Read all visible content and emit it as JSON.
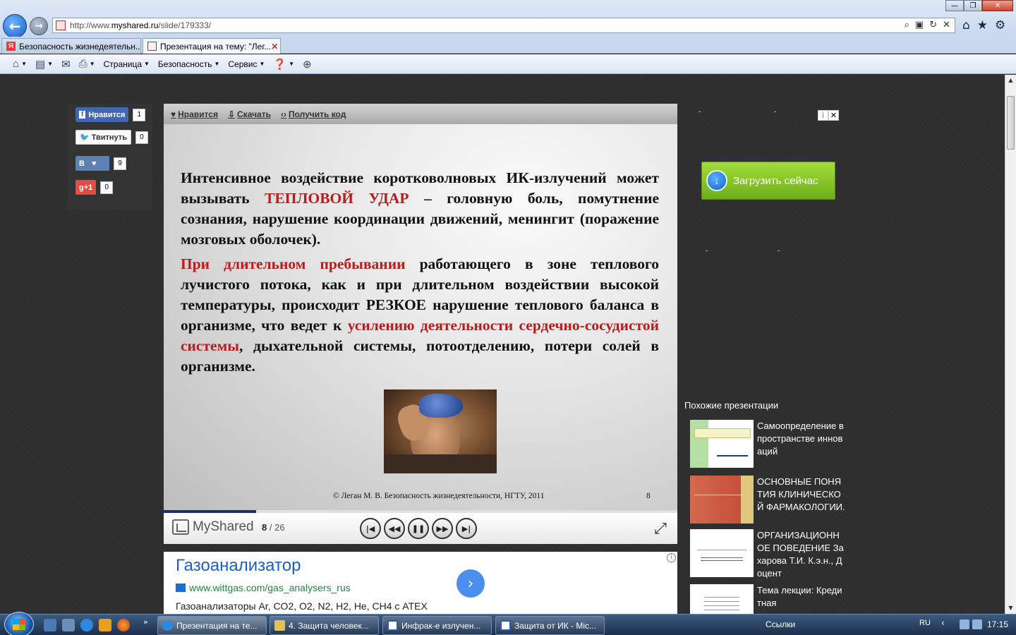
{
  "browser": {
    "url_prefix": "http://www.",
    "url_domain": "myshared.ru",
    "url_path": "/slide/179333/",
    "tabs": [
      {
        "label": "Безопасность жизнедеятельн..."
      },
      {
        "label": "Презентация на тему: \"Лег..."
      }
    ],
    "commands": {
      "page": "Страница",
      "security": "Безопасность",
      "service": "Сервис"
    },
    "window_controls": {
      "min": "—",
      "max": "❐",
      "close": "✕"
    }
  },
  "social": {
    "facebook_label": "Нравится",
    "facebook_count": "1",
    "twitter_label": "Твитнуть",
    "twitter_count": "0",
    "vk_label": "В",
    "vk_count": "9",
    "gplus_label": "g+1",
    "gplus_count": "0"
  },
  "player": {
    "like_label": "Нравится",
    "download_label": "Скачать",
    "embed_label": "Получить код",
    "logo_text": "MyShared",
    "current_slide": "8",
    "total_slides": "/ 26",
    "progress": 0.18
  },
  "slide": {
    "p1_part1": "Интенсивное воздействие коротковолновых ИК-излучений может вызывать ",
    "p1_red": "ТЕПЛОВОЙ УДАР",
    "p1_part2": " – головную боль, помутнение сознания, нарушение координации движений, менингит (поражение мозговых оболочек).",
    "p2_red1": "При длительном пребывании",
    "p2_part1": " работающего в зоне теплового лучистого потока, как и при длительном воздействии высокой температуры, происходит РЕЗКОЕ нарушение теплового баланса в организме, что ведет к ",
    "p2_red2": "усилению деятельности сердечно-сосудистой системы",
    "p2_part2": ", дыхательной системы, потоотделению, потери солей в организме.",
    "copyright": "© Леган М. В. Безопасность жизнедеятельности, НГТУ, 2011",
    "slide_number": "8"
  },
  "ad_bottom": {
    "title": "Газоанализатор",
    "url": "www.wittgas.com/gas_analysers_rus",
    "description": "Газоанализаторы Ar, CO2, O2, N2, H2, He, CH4 с ATEX"
  },
  "ad_right": {
    "button_label": "Загрузить сейчас"
  },
  "similar": {
    "title": "Похожие презентации",
    "items": [
      {
        "title": "Самоопределение в пространстве инноваций"
      },
      {
        "title": "ОСНОВНЫЕ ПОНЯТИЯ КЛИНИЧЕСКОЙ ФАРМАКОЛОГИИ."
      },
      {
        "title": "ОРГАНИЗАЦИОННОЕ ПОВЕДЕНИЕ Захарова Т.И. К.э.н., Доцент"
      },
      {
        "title": "Тема лекции: Кредитная"
      }
    ]
  },
  "taskbar": {
    "tasks": [
      {
        "label": "Презентация на те..."
      },
      {
        "label": "4. Защита человек..."
      },
      {
        "label": "Инфрак-е излучен..."
      },
      {
        "label": "Защита от ИК - Mic..."
      }
    ],
    "links": "Ссылки",
    "lang": "RU",
    "time": "17:15"
  },
  "colors": {
    "accent": "#1a2c7a",
    "slide_red": "#b81c1c",
    "ad_link": "#1a5fc8",
    "download_green": "#7dc21e"
  }
}
